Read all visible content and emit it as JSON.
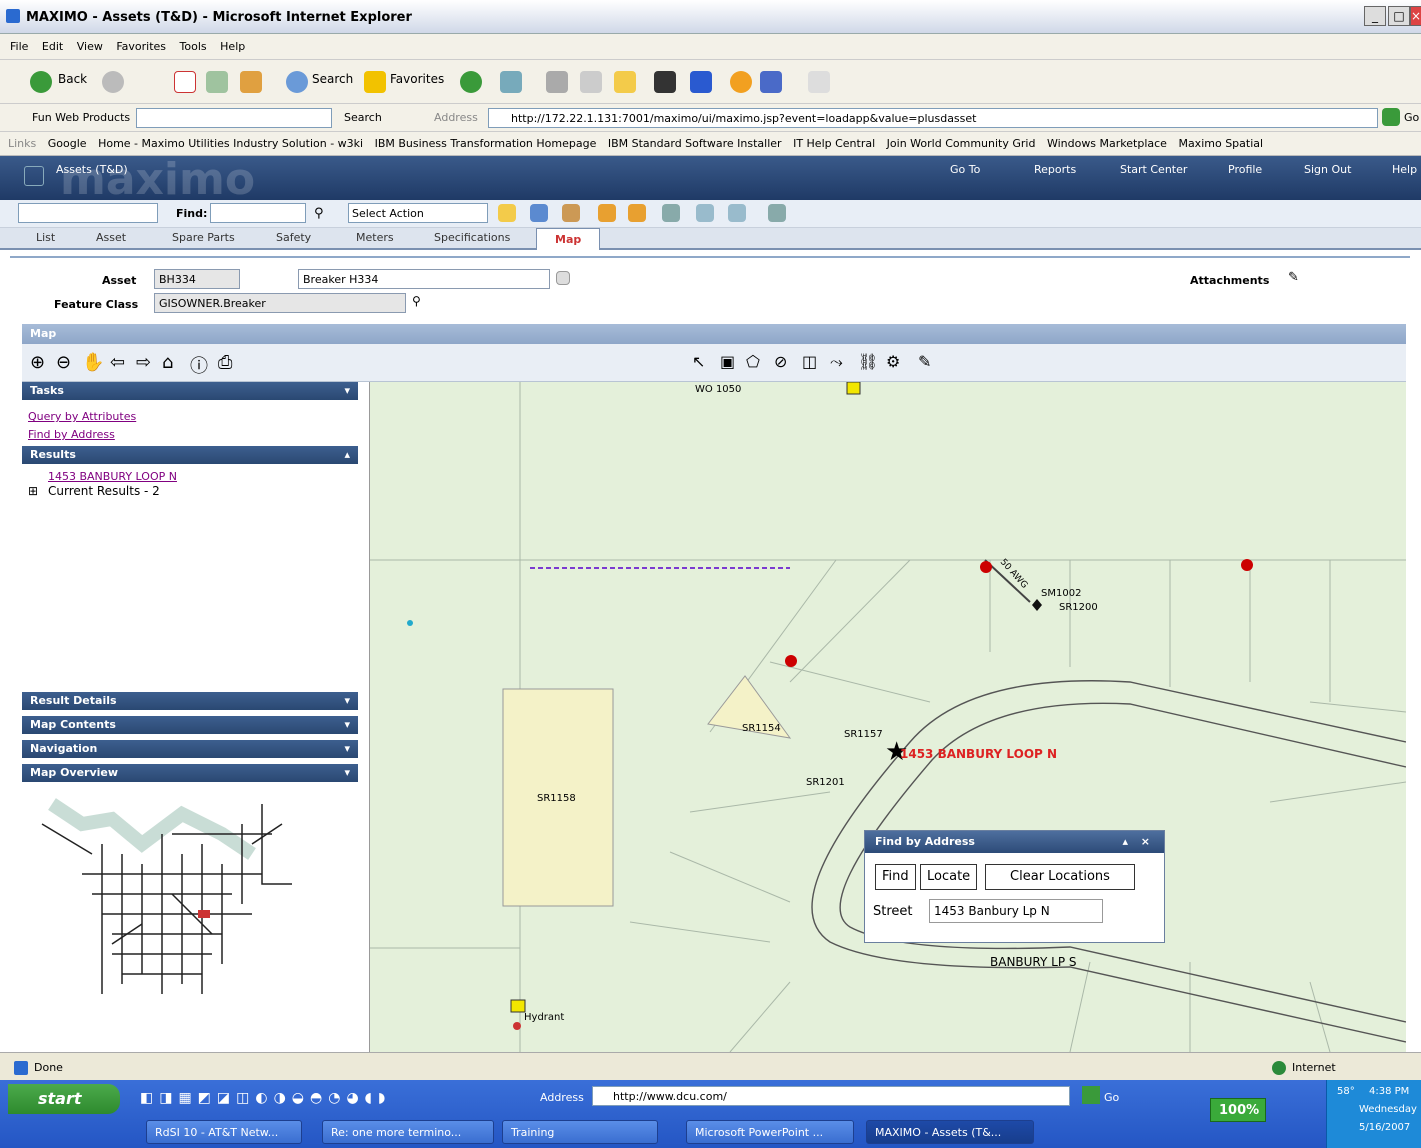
{
  "browser": {
    "title": "MAXIMO - Assets (T&D) - Microsoft Internet Explorer",
    "menu": [
      "File",
      "Edit",
      "View",
      "Favorites",
      "Tools",
      "Help"
    ],
    "toolbar": {
      "back": "Back",
      "search": "Search",
      "favorites": "Favorites"
    },
    "fun_web": "Fun Web Products",
    "fun_search": "Search",
    "address_label": "Address",
    "address_url": "http://172.22.1.131:7001/maximo/ui/maximo.jsp?event=loadapp&value=plusdasset",
    "go": "Go",
    "links_label": "Links",
    "links": [
      "Google",
      "Home - Maximo Utilities Industry Solution - w3ki",
      "IBM Business Transformation Homepage",
      "IBM Standard Software Installer",
      "IT Help Central",
      "Join World Community Grid",
      "Windows Marketplace",
      "Maximo Spatial"
    ]
  },
  "maximo": {
    "logo": "maximo",
    "app_name": "Assets (T&D)",
    "nav": [
      "Go To",
      "Reports",
      "Start Center",
      "Profile",
      "Sign Out",
      "Help"
    ],
    "find_label": "Find:",
    "select_action": "Select Action",
    "tabs": [
      "List",
      "Asset",
      "Spare Parts",
      "Safety",
      "Meters",
      "Specifications",
      "Map"
    ],
    "asset_label": "Asset",
    "asset_value": "BH334",
    "asset_desc": "Breaker H334",
    "feature_class_label": "Feature Class",
    "feature_class_value": "GISOWNER.Breaker",
    "attachments": "Attachments",
    "map_section": "Map"
  },
  "panel": {
    "tasks": "Tasks",
    "query_link": "Query by Attributes",
    "find_link": "Find by Address",
    "results": "Results",
    "result_item": "1453 BANBURY LOOP N",
    "current_results": "Current Results - 2",
    "sections": [
      "Result Details",
      "Map Contents",
      "Navigation",
      "Map Overview"
    ]
  },
  "map": {
    "labels": {
      "wo": "WO 1050",
      "sm1002": "SM1002",
      "sr1200": "SR1200",
      "sr1154": "SR1154",
      "sr1157": "SR1157",
      "sr1201": "SR1201",
      "sr1158": "SR1158",
      "address": "1453 BANBURY LOOP N",
      "street": "BANBURY LP S",
      "hydrant": "Hydrant",
      "dim": "50 AWG"
    }
  },
  "find_dialog": {
    "title": "Find by Address",
    "find": "Find",
    "locate": "Locate",
    "clear": "Clear Locations",
    "street_label": "Street",
    "street_value": "1453 Banbury Lp N"
  },
  "status": {
    "done": "Done",
    "zone": "Internet"
  },
  "taskbar": {
    "start": "start",
    "address_label": "Address",
    "address_url": "http://www.dcu.com/",
    "go": "Go",
    "zoom": "100%",
    "tasks": [
      "RdSI 10 - AT&T Netw...",
      "Re: one more termino...",
      "Training",
      "Microsoft PowerPoint ...",
      "MAXIMO - Assets (T&..."
    ],
    "time": "4:38 PM",
    "day": "Wednesday",
    "date": "5/16/2007",
    "temp": "58°"
  }
}
